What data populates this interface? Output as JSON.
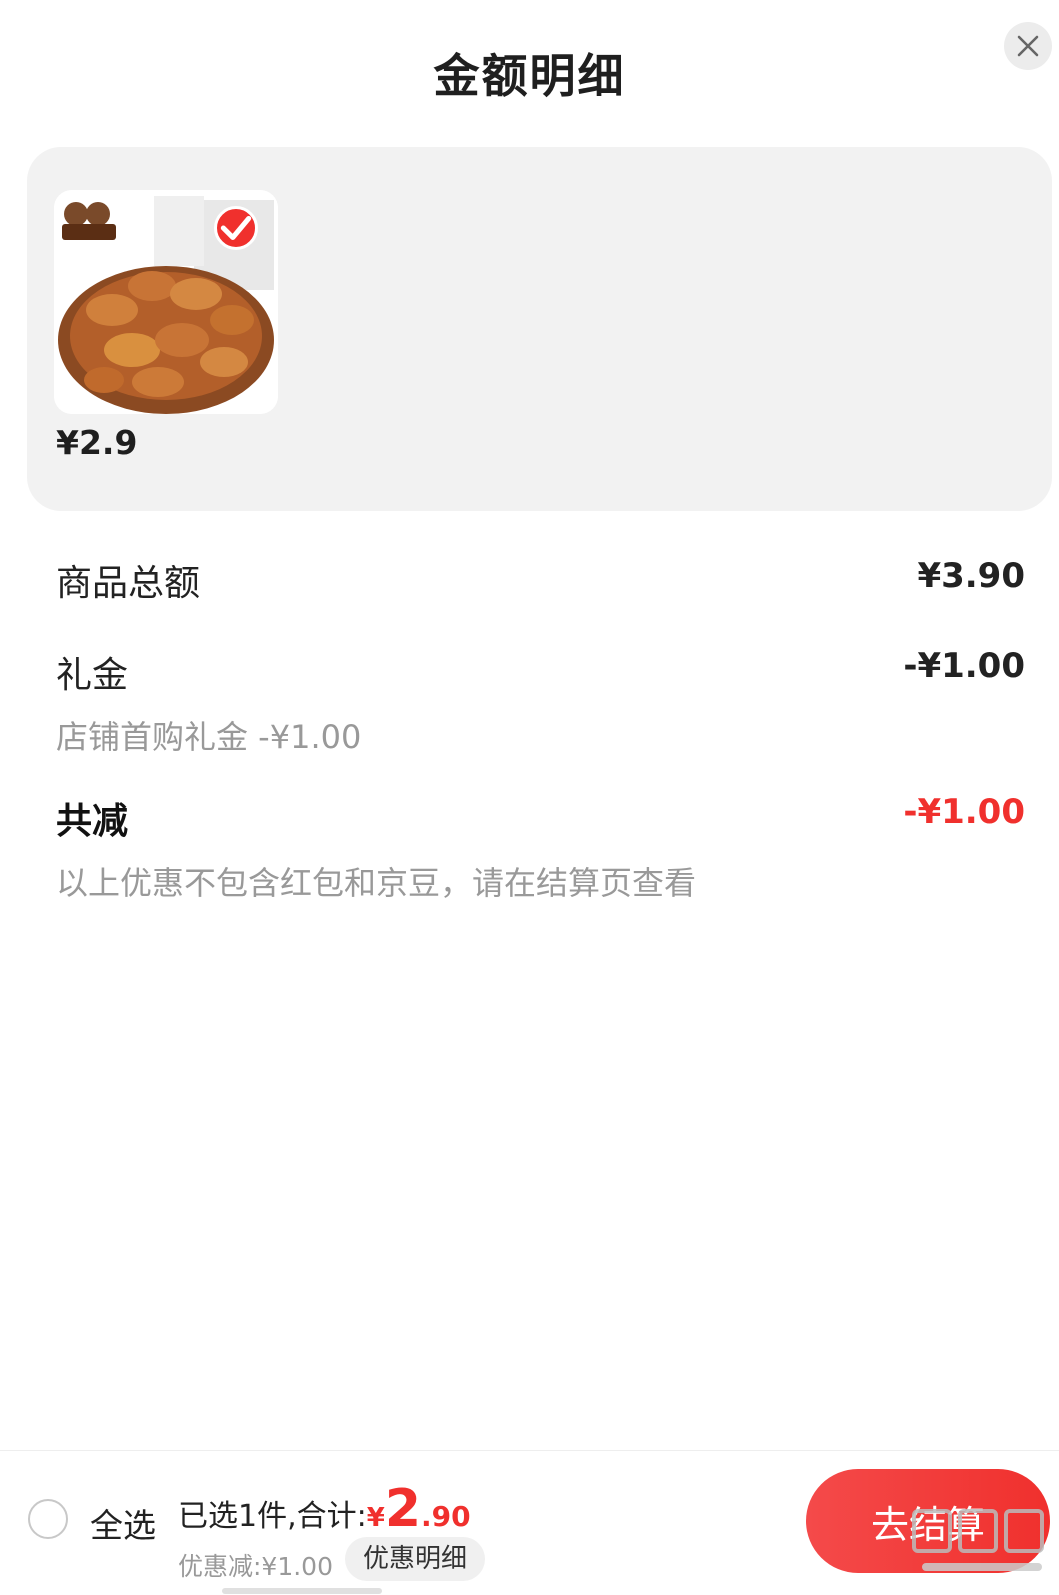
{
  "sheet": {
    "title": "金额明细",
    "close_icon": "close-icon"
  },
  "product": {
    "price": "¥2.9",
    "selected": true,
    "image_icon": "product-thumbnail-icon",
    "check_icon": "check-circle-icon"
  },
  "breakdown": {
    "goods_total_label": "商品总额",
    "goods_total_value": "¥3.90",
    "gift_label": "礼金",
    "gift_value": "-¥1.00",
    "gift_note": "店铺首购礼金 -¥1.00",
    "total_reduce_label": "共减",
    "total_reduce_value": "-¥1.00",
    "total_reduce_note": "以上优惠不包含红包和京豆，请在结算页查看"
  },
  "bottom_bar": {
    "select_all_label": "全选",
    "selected_summary": "已选1件,合计:",
    "total_currency": "¥",
    "total_integer": "2",
    "total_decimal": ".90",
    "discount_text": "优惠减:¥1.00",
    "discount_detail_label": "优惠明细",
    "checkout_label": "去结算"
  },
  "colors": {
    "accent_red": "#f0302d",
    "panel_gray": "#f2f2f2",
    "muted_text": "#999999"
  }
}
